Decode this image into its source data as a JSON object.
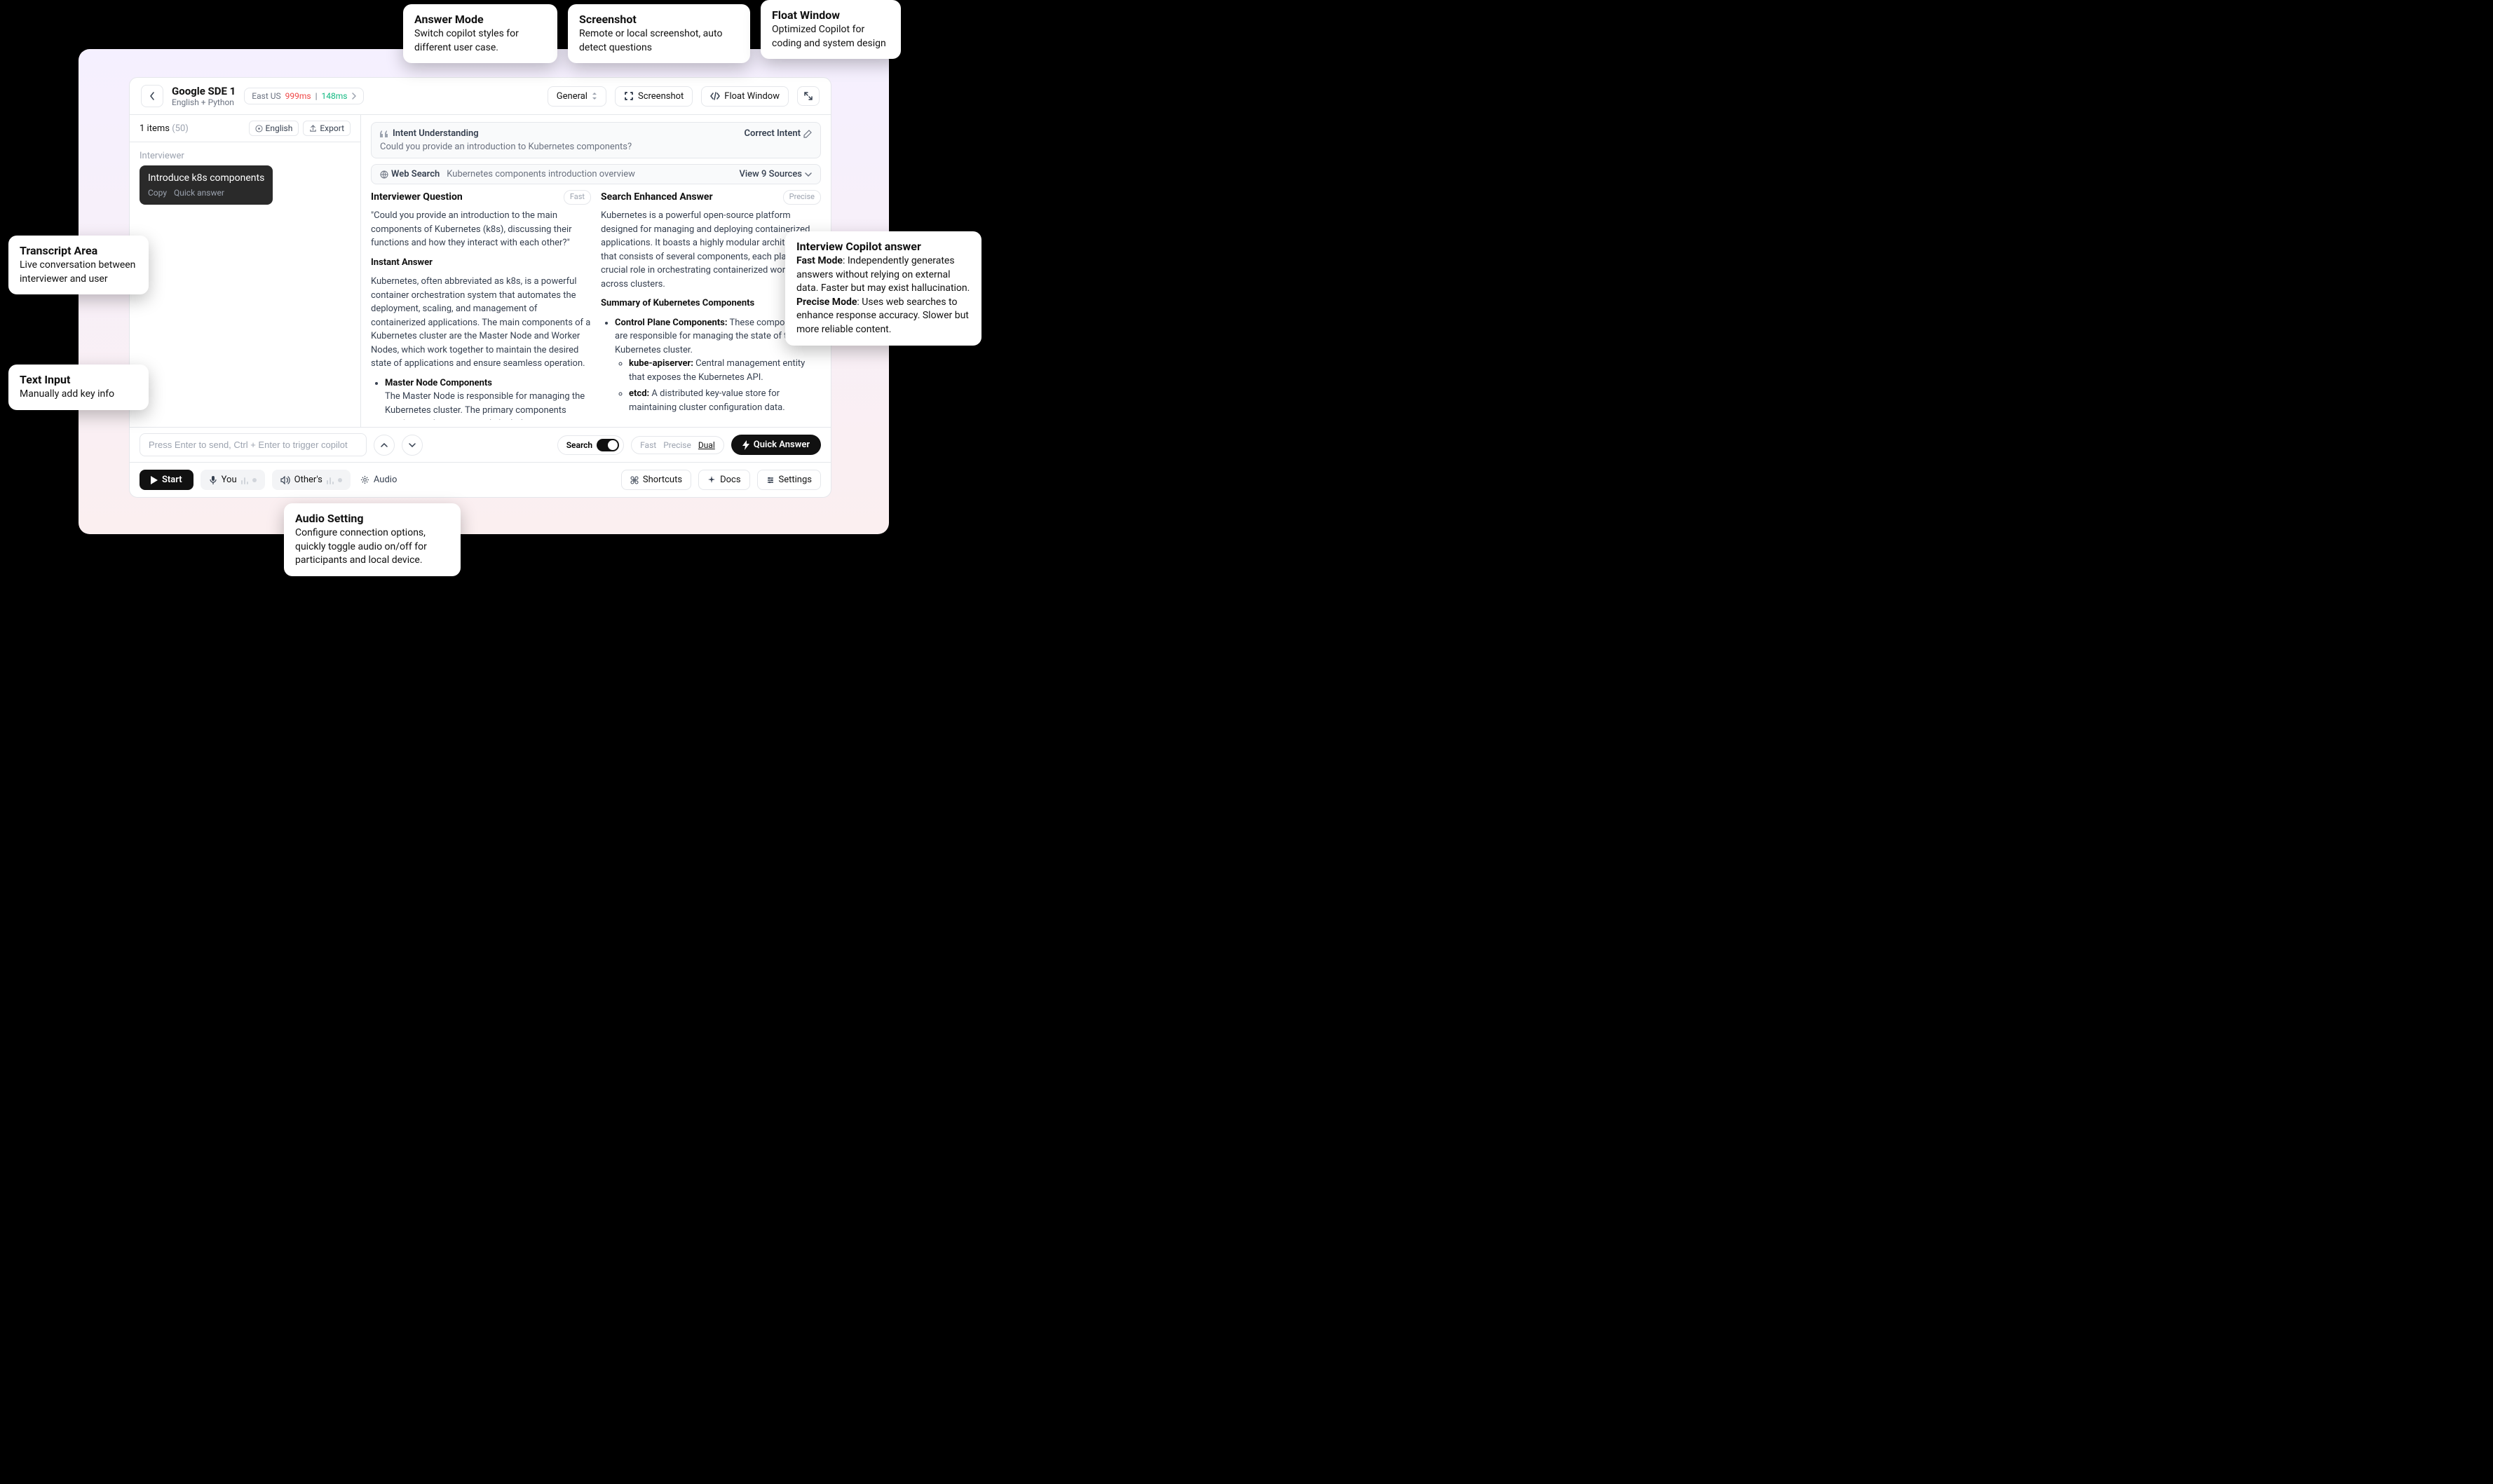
{
  "header": {
    "title": "Google SDE 1",
    "subtitle": "English + Python",
    "region": "East US",
    "latency1": "999ms",
    "latency2": "148ms",
    "general": "General",
    "screenshot": "Screenshot",
    "float": "Float Window"
  },
  "left": {
    "items_count": "1 items",
    "items_muted": "(50)",
    "english": "English",
    "export": "Export",
    "role": "Interviewer",
    "message": "Introduce k8s components",
    "copy": "Copy",
    "quick": "Quick answer",
    "input_placeholder": "Press Enter to send, Ctrl + Enter to trigger copilot"
  },
  "intent": {
    "label": "Intent Understanding",
    "correct": "Correct Intent",
    "question": "Could you provide an introduction to Kubernetes components?"
  },
  "search": {
    "label": "Web Search",
    "query": "Kubernetes components introduction overview",
    "sources": "View 9 Sources"
  },
  "fast": {
    "title": "Interviewer Question",
    "badge": "Fast",
    "question": "\"Could you provide an introduction to the main components of Kubernetes (k8s), discussing their functions and how they interact with each other?\"",
    "instant_label": "Instant Answer",
    "instant_body": "Kubernetes, often abbreviated as k8s, is a powerful container orchestration system that automates the deployment, scaling, and management of containerized applications. The main components of a Kubernetes cluster are the Master Node and Worker Nodes, which work together to maintain the desired state of applications and ensure seamless operation.",
    "li1_title": "Master Node Components",
    "li1_body": "The Master Node is responsible for managing the Kubernetes cluster. The primary components running on the master node include:"
  },
  "precise": {
    "title": "Search Enhanced Answer",
    "badge": "Precise",
    "intro": "Kubernetes is a powerful open-source platform designed for managing and deploying containerized applications. It boasts a highly modular architecture that consists of several components, each playing a crucial role in orchestrating containerized workloads across clusters.",
    "summary_title": "Summary of Kubernetes Components",
    "bullet1_label": "Control Plane Components:",
    "bullet1_body": " These components are responsible for managing the state of the Kubernetes cluster.",
    "sub1_label": "kube-apiserver:",
    "sub1_body": " Central management entity that exposes the Kubernetes API.",
    "sub2_label": "etcd:",
    "sub2_body": " A distributed key-value store for maintaining cluster configuration data."
  },
  "controls": {
    "search": "Search",
    "fast": "Fast",
    "precise": "Precise",
    "dual": "Dual",
    "quick_answer": "Quick Answer"
  },
  "bottom": {
    "start": "Start",
    "you": "You",
    "others": "Other's",
    "audio": "Audio",
    "shortcuts": "Shortcuts",
    "docs": "Docs",
    "settings": "Settings"
  },
  "callouts": {
    "answer_mode_title": "Answer Mode",
    "answer_mode_body": "Switch copilot styles for different user case.",
    "screenshot_title": "Screenshot",
    "screenshot_body": "Remote or local screenshot, auto detect questions",
    "float_title": "Float Window",
    "float_body": "Optimized Copilot for coding and system design",
    "transcript_title": "Transcript Area",
    "transcript_body": "Live conversation between interviewer and user",
    "textinput_title": "Text Input",
    "textinput_body": "Manually add key info",
    "audio_title": "Audio Setting",
    "audio_body": "Configure connection options, quickly toggle audio on/off for participants and local device.",
    "answer_title": "Interview Copilot answer",
    "answer_fast_label": "Fast Mode",
    "answer_fast_body": ": Independently generates answers without relying on external data. Faster but may exist hallucination.",
    "answer_precise_label": "Precise Mode",
    "answer_precise_body": ": Uses web searches to enhance response accuracy. Slower but more reliable content."
  }
}
